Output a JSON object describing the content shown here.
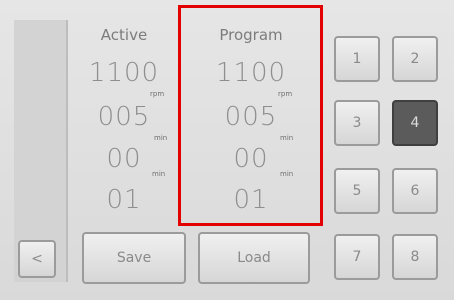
{
  "active": {
    "header": "Active",
    "speed": "1100",
    "speed_unit": "rpm",
    "time1": "005",
    "time1_unit": "min",
    "time2": "00",
    "time2_unit": "min",
    "count": "01"
  },
  "program": {
    "header": "Program",
    "speed": "1100",
    "speed_unit": "rpm",
    "time1": "005",
    "time1_unit": "min",
    "time2": "00",
    "time2_unit": "min",
    "count": "01"
  },
  "buttons": {
    "back": "<",
    "save": "Save",
    "load": "Load"
  },
  "keypad": [
    "1",
    "2",
    "3",
    "4",
    "5",
    "6",
    "7",
    "8"
  ],
  "selected_program": "4",
  "colors": {
    "highlight": "#e20000",
    "selected_key": "#5b5b5b"
  }
}
